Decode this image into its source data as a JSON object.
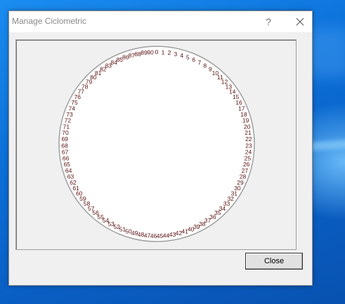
{
  "window": {
    "title": "Manage Ciclometric",
    "help_label": "?",
    "close_icon": "close-icon"
  },
  "dial": {
    "labels": [
      "0",
      "1",
      "2",
      "3",
      "4",
      "5",
      "6",
      "7",
      "8",
      "9",
      "10",
      "11",
      "12",
      "13",
      "14",
      "15",
      "16",
      "17",
      "18",
      "19",
      "20",
      "21",
      "22",
      "23",
      "24",
      "25",
      "26",
      "27",
      "28",
      "29",
      "30",
      "31",
      "32",
      "33",
      "34",
      "35",
      "36",
      "37",
      "38",
      "39",
      "40",
      "41",
      "42",
      "43",
      "44",
      "45",
      "46",
      "47",
      "48",
      "49",
      "50",
      "51",
      "52",
      "53",
      "54",
      "55",
      "56",
      "57",
      "58",
      "59",
      "60",
      "61",
      "62",
      "63",
      "64",
      "65",
      "66",
      "67",
      "68",
      "69",
      "70",
      "71",
      "72",
      "73",
      "74",
      "75",
      "76",
      "77",
      "78",
      "79",
      "80",
      "81",
      "82",
      "83",
      "84",
      "85",
      "86",
      "87",
      "88",
      "89",
      "90"
    ],
    "label_color": "#5a1010",
    "ring_color": "#a0a0a0"
  },
  "buttons": {
    "close_label": "Close"
  }
}
